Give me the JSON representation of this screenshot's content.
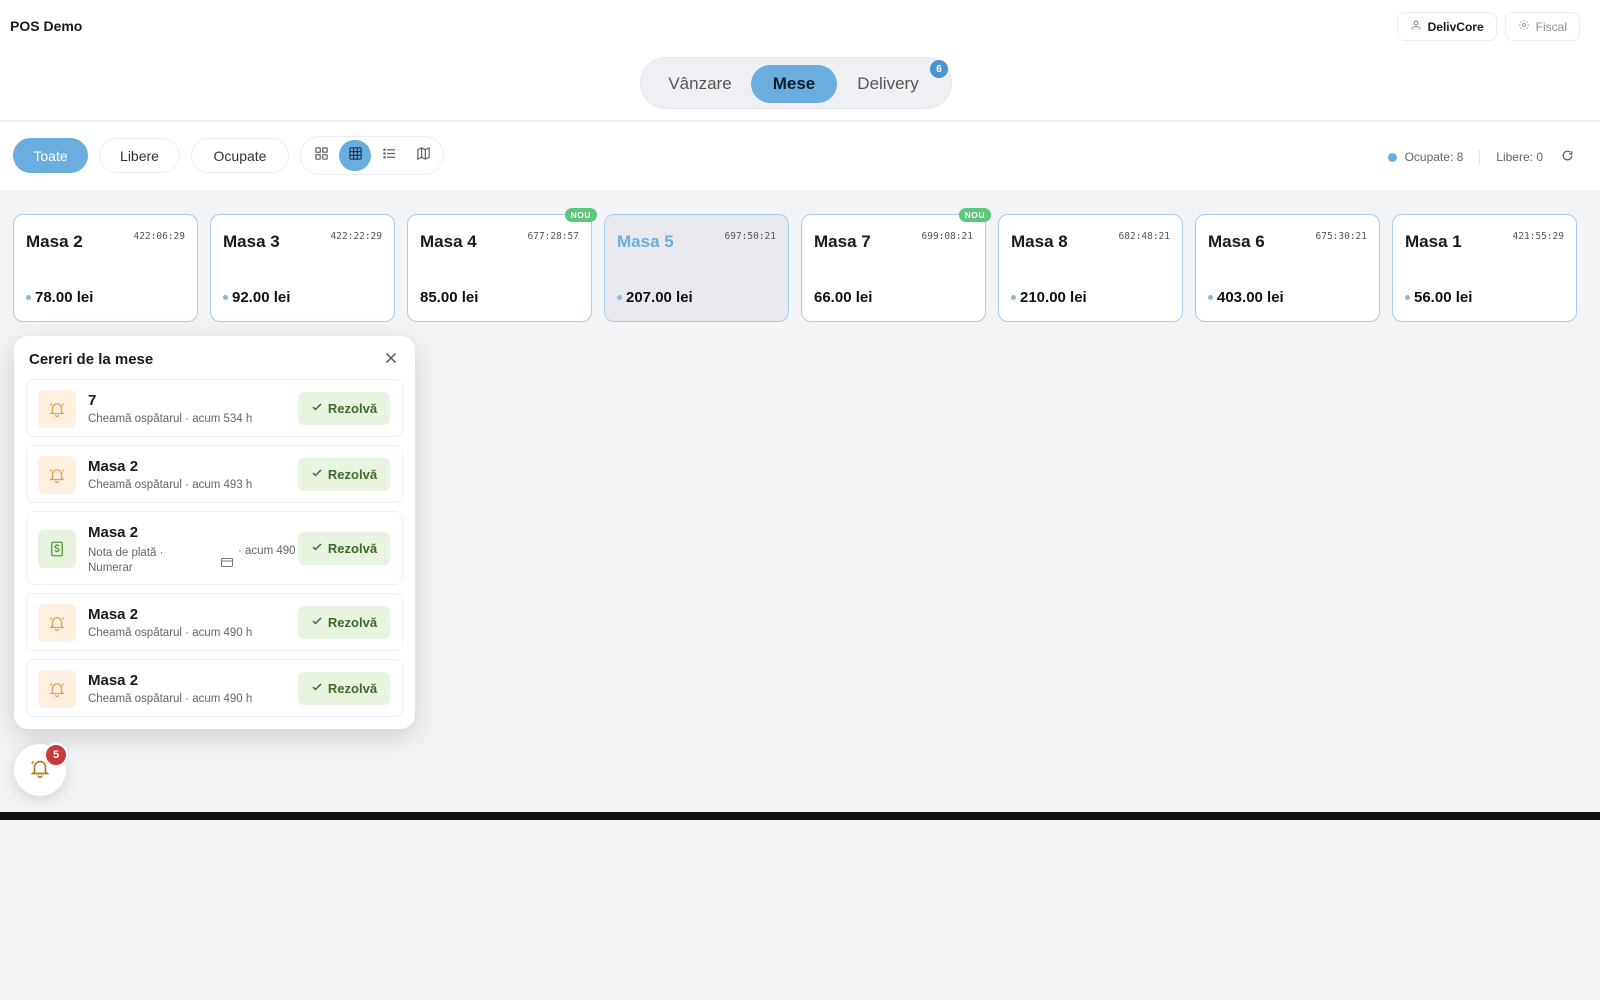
{
  "brand": "POS Demo",
  "top_right": {
    "user_label": "DelivCore",
    "fiscal_label": "Fiscal"
  },
  "segment": {
    "items": [
      "Vânzare",
      "Mese",
      "Delivery"
    ],
    "active": "Mese",
    "delivery_badge": "6"
  },
  "filters": {
    "items": [
      "Toate",
      "Libere",
      "Ocupate"
    ],
    "active": "Toate",
    "views": [
      "grid-icon",
      "table-grid-icon",
      "list-icon",
      "map-icon"
    ],
    "active_view": "table-grid-icon"
  },
  "stats": {
    "occupied": "Ocupate: 8",
    "free": "Libere: 0"
  },
  "tables": [
    {
      "name": "Masa 2",
      "time": "422:06:29",
      "amount": "78.00 lei",
      "dot": true,
      "nou": false,
      "selected": false
    },
    {
      "name": "Masa 3",
      "time": "422:22:29",
      "amount": "92.00 lei",
      "dot": true,
      "nou": false,
      "selected": false
    },
    {
      "name": "Masa 4",
      "time": "677:28:57",
      "amount": "85.00 lei",
      "dot": false,
      "nou": true,
      "selected": false
    },
    {
      "name": "Masa 5",
      "time": "697:50:21",
      "amount": "207.00 lei",
      "dot": true,
      "nou": false,
      "selected": true
    },
    {
      "name": "Masa 7",
      "time": "699:08:21",
      "amount": "66.00 lei",
      "dot": false,
      "nou": true,
      "selected": false
    },
    {
      "name": "Masa 8",
      "time": "682:48:21",
      "amount": "210.00 lei",
      "dot": true,
      "nou": false,
      "selected": false
    },
    {
      "name": "Masa 6",
      "time": "675:30:21",
      "amount": "403.00 lei",
      "dot": true,
      "nou": false,
      "selected": false
    },
    {
      "name": "Masa 1",
      "time": "421:55:29",
      "amount": "56.00 lei",
      "dot": true,
      "nou": false,
      "selected": false
    }
  ],
  "nou_label": "NOU",
  "requests": {
    "title": "Cereri de la mese",
    "resolve_label": "Rezolvă",
    "items": [
      {
        "name": "7",
        "type": "bell",
        "sub": "Cheamă ospătarul · acum 534 h"
      },
      {
        "name": "Masa 2",
        "type": "bell",
        "sub": "Cheamă ospătarul · acum 493 h"
      },
      {
        "name": "Masa 2",
        "type": "cash",
        "sub_left": "Nota de plată · Numerar",
        "sub_right": "· acum 490 h"
      },
      {
        "name": "Masa 2",
        "type": "bell",
        "sub": "Cheamă ospătarul · acum 490 h"
      },
      {
        "name": "Masa 2",
        "type": "bell",
        "sub": "Cheamă ospătarul · acum 490 h"
      }
    ]
  },
  "fab_badge": "5",
  "colors": {
    "accent": "#6aaee0",
    "nou": "#5cc77b",
    "resolve_bg": "#e8f4e0",
    "badge_red": "#c73a3a"
  }
}
